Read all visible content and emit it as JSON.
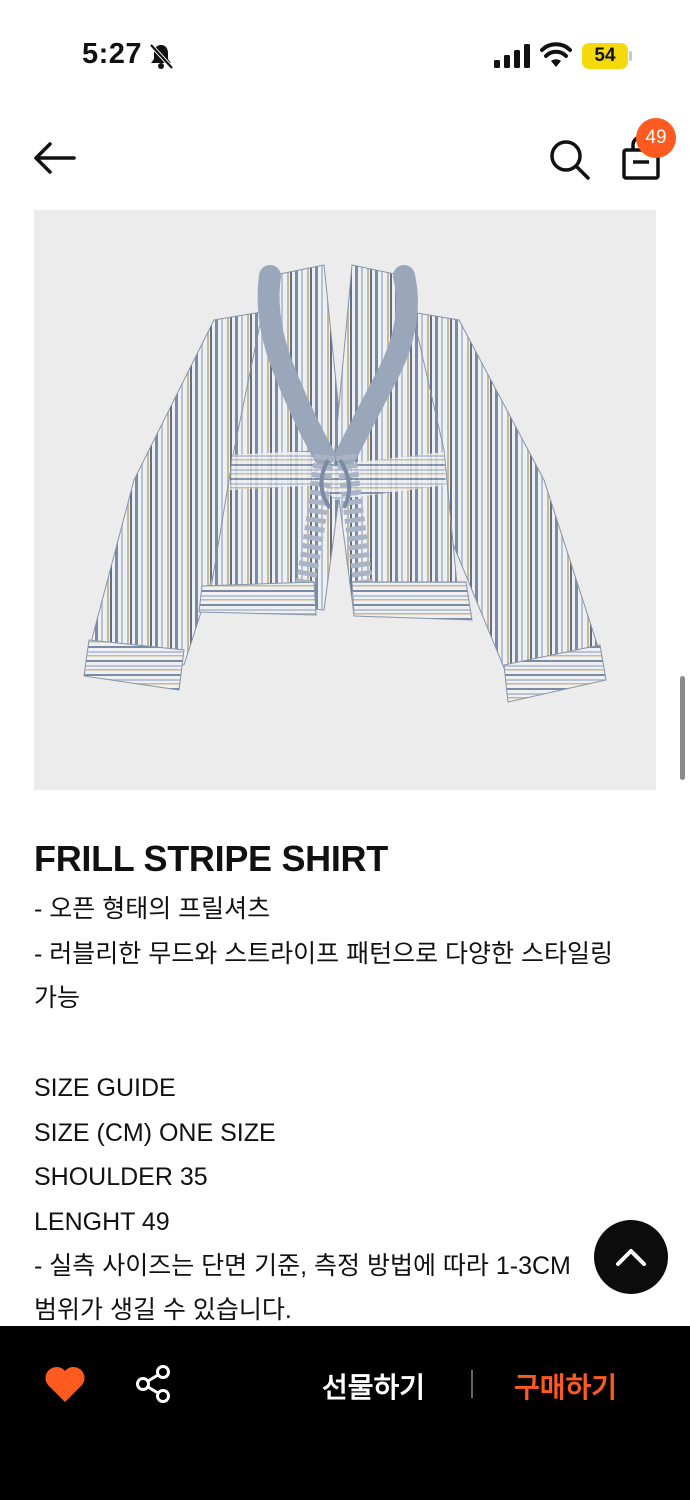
{
  "status_bar": {
    "time": "5:27",
    "battery": "54",
    "icons": [
      "bell-slash-icon",
      "cellular-signal-icon",
      "wifi-icon",
      "battery-icon"
    ]
  },
  "nav": {
    "cart_count": "49",
    "icons": [
      "arrow-left-icon",
      "search-icon",
      "shopping-bag-icon"
    ]
  },
  "product": {
    "title": "FRILL STRIPE SHIRT",
    "description_lines": [
      "- 오픈 형태의 프릴셔츠",
      "- 러블리한 무드와 스트라이프 패턴으로 다양한 스타일링",
      "가능",
      "",
      "SIZE GUIDE",
      "SIZE (CM) ONE SIZE",
      "SHOULDER 35",
      "LENGHT 49",
      "- 실측 사이즈는 단면 기준, 측정 방법에 따라 1-3CM",
      "범위가 생길 수 있습니다."
    ]
  },
  "bottom_bar": {
    "gift_label": "선물하기",
    "buy_label": "구매하기",
    "icons": [
      "heart-icon",
      "share-icon"
    ]
  },
  "colors": {
    "accent": "#ff5a1f",
    "battery": "#f5d90a",
    "bottom_bar_bg": "#000000",
    "image_bg": "#ececec"
  }
}
